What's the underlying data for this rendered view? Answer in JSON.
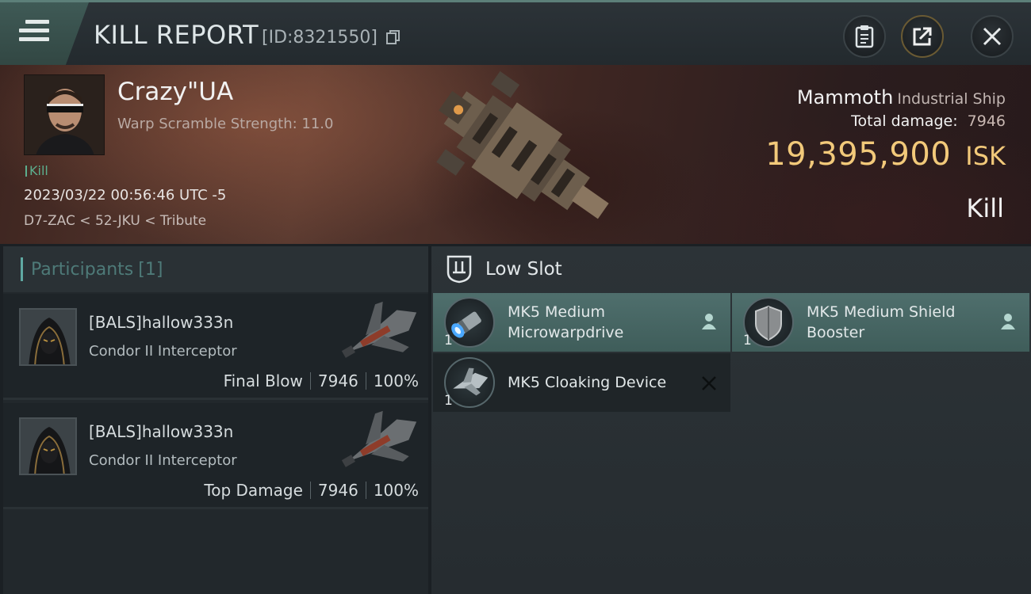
{
  "header": {
    "title": "KILL REPORT",
    "id_label": "[ID:8321550]",
    "icons": [
      "menu-icon",
      "copy-icon",
      "clipboard-icon",
      "share-icon",
      "close-icon"
    ]
  },
  "victim": {
    "name": "Crazy\"UA",
    "warp_scramble": "Warp Scramble Strength: 11.0",
    "kill_tag": "Kill",
    "timestamp": "2023/03/22 00:56:46 UTC -5",
    "location": "D7-ZAC < 52-JKU < Tribute",
    "ship_name": "Mammoth",
    "ship_class": "Industrial Ship",
    "total_damage_label": "Total damage:",
    "total_damage": "7946",
    "isk_value": "19,395,900",
    "isk_unit": "ISK",
    "report_type": "Kill"
  },
  "participants": {
    "title": "Participants",
    "count": "[1]",
    "rows": [
      {
        "name": "[BALS]hallow333n",
        "ship": "Condor II Interceptor",
        "role": "Final Blow",
        "damage": "7946",
        "percent": "100%"
      },
      {
        "name": "[BALS]hallow333n",
        "ship": "Condor II Interceptor",
        "role": "Top Damage",
        "damage": "7946",
        "percent": "100%"
      }
    ]
  },
  "slots": {
    "title": "Low Slot",
    "modules": [
      {
        "name_line1": "MK5 Medium",
        "name_line2": "Microwarpdrive",
        "qty": "1",
        "status": "dropped"
      },
      {
        "name_line1": "MK5 Medium Shield",
        "name_line2": "Booster",
        "qty": "1",
        "status": "dropped"
      },
      {
        "name_line1": "MK5 Cloaking Device",
        "name_line2": "",
        "qty": "1",
        "status": "destroyed"
      }
    ]
  },
  "colors": {
    "accent_teal": "#5fa9a2",
    "isk_gold": "#f2c97a",
    "module_dropped_bg": "#4f6f6d",
    "kill_tag_green": "#5cae8e"
  }
}
